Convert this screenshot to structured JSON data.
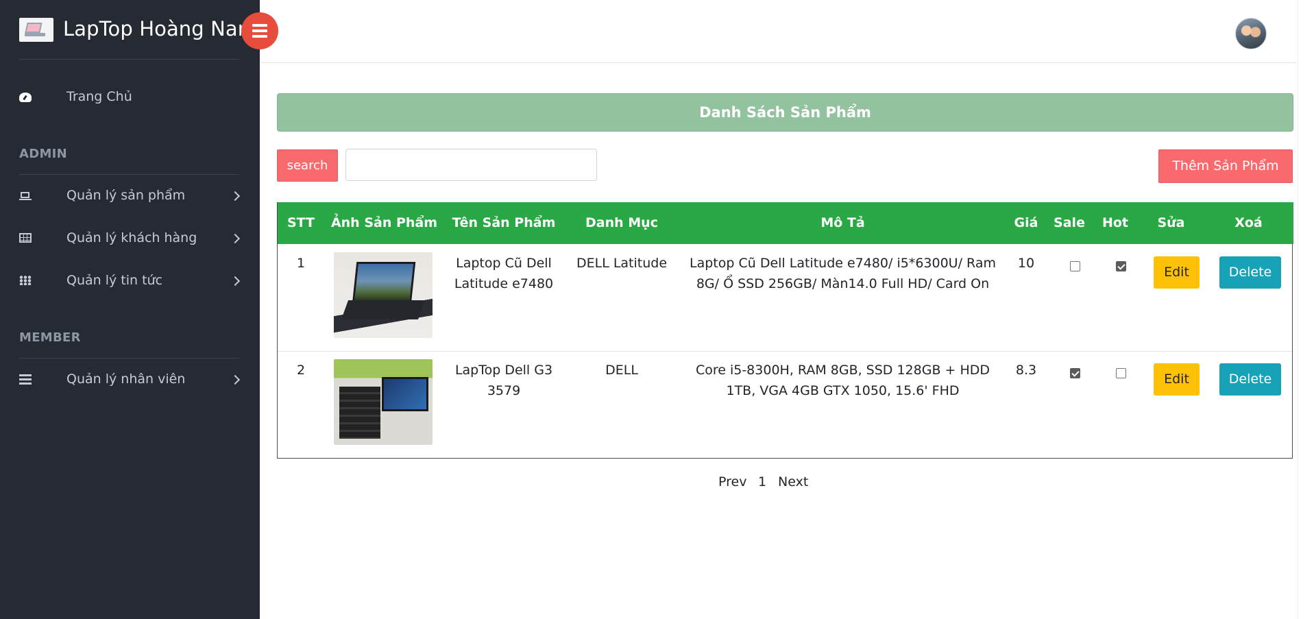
{
  "brand": {
    "name": "LapTop Hoàng Nam",
    "logo_icon": "laptop-logo-icon"
  },
  "sidebar": {
    "home": {
      "label": "Trang Chủ",
      "icon": "dashboard-icon"
    },
    "sections": [
      {
        "title": "ADMIN"
      },
      {
        "title": "MEMBER"
      }
    ],
    "items": [
      {
        "label": "Quản lý sản phẩm",
        "icon": "laptop-icon"
      },
      {
        "label": "Quản lý khách hàng",
        "icon": "table-icon"
      },
      {
        "label": "Quản lý tin tức",
        "icon": "grid-icon"
      },
      {
        "label": "Quản lý nhân viên",
        "icon": "list-icon"
      }
    ]
  },
  "main": {
    "banner_title": "Danh Sách Sản Phẩm",
    "search_label": "search",
    "search_value": "",
    "add_label": "Thêm Sản Phẩm",
    "columns": [
      "STT",
      "Ảnh Sản Phẩm",
      "Tên Sản Phẩm",
      "Danh Mục",
      "Mô Tả",
      "Giá",
      "Sale",
      "Hot",
      "Sửa",
      "Xoá"
    ],
    "rows": [
      {
        "stt": "1",
        "name": "Laptop Cũ Dell Latitude e7480",
        "category": "DELL Latitude",
        "description": "Laptop Cũ Dell Latitude e7480/ i5*6300U/ Ram 8G/ Ổ SSD 256GB/ Màn14.0 Full HD/ Card On",
        "price": "10",
        "sale": false,
        "hot": true,
        "edit_label": "Edit",
        "delete_label": "Delete"
      },
      {
        "stt": "2",
        "name": "LapTop Dell G3 3579",
        "category": "DELL",
        "description": "Core i5-8300H, RAM 8GB, SSD 128GB + HDD 1TB, VGA 4GB GTX 1050, 15.6' FHD",
        "price": "8.3",
        "sale": true,
        "hot": false,
        "edit_label": "Edit",
        "delete_label": "Delete"
      }
    ],
    "pagination": {
      "prev": "Prev",
      "page": "1",
      "next": "Next"
    }
  },
  "colors": {
    "sidebar_bg": "#262b33",
    "toggle": "#e74c3c",
    "banner": "#93c29f",
    "table_header": "#29a845",
    "danger_btn": "#f86a6e",
    "edit_btn": "#ffc107",
    "delete_btn": "#17a2b8"
  }
}
